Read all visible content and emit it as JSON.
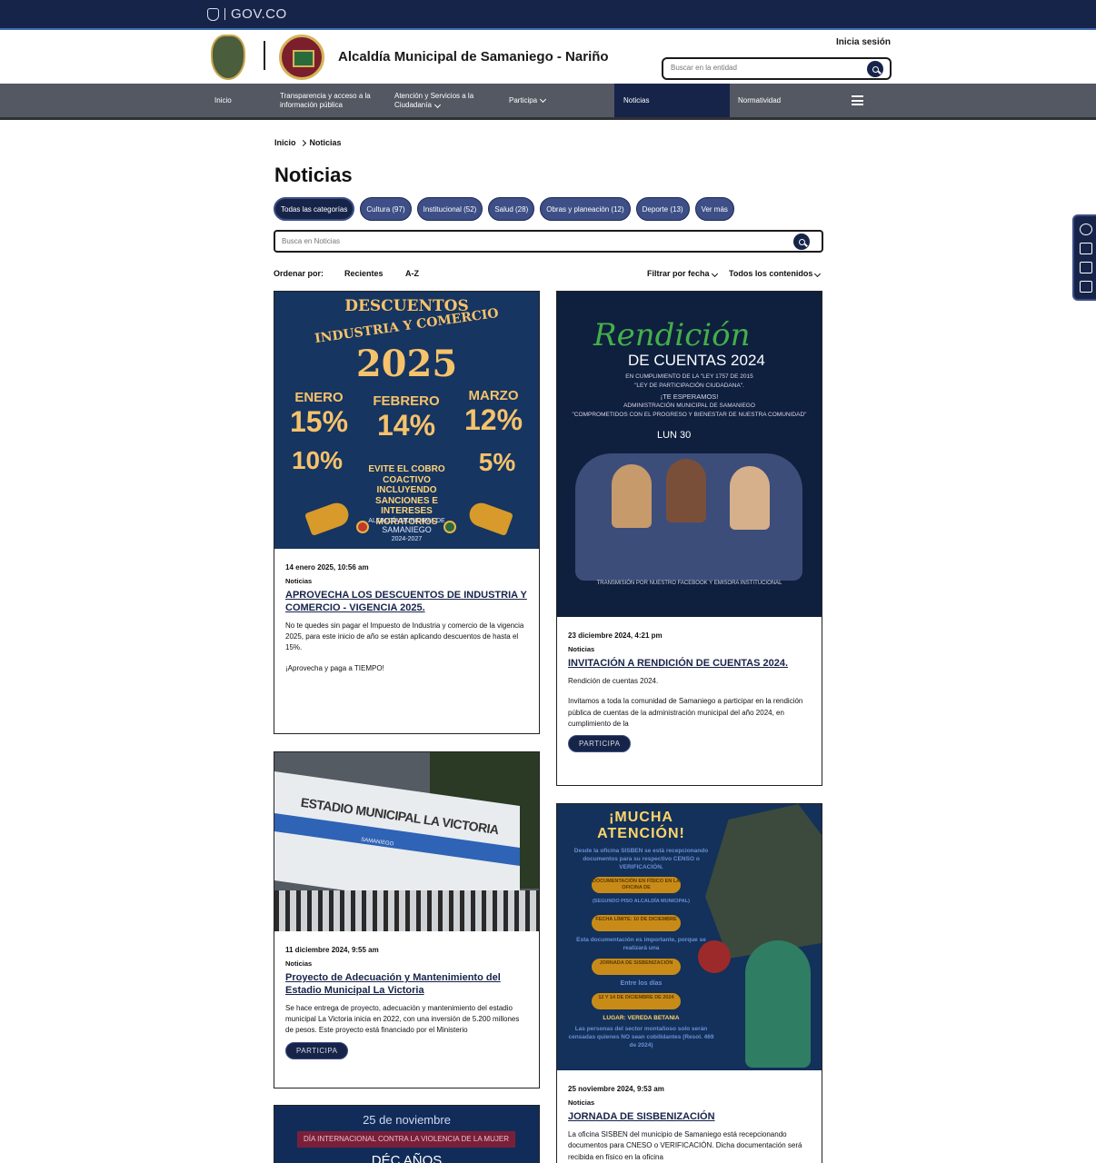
{
  "topbar": {
    "brand": "GOV.CO"
  },
  "header": {
    "site_title": "Alcaldía Municipal de Samaniego - Nariño",
    "login": "Inicia sesión",
    "search_placeholder": "Buscar en la entidad"
  },
  "nav": {
    "items": [
      {
        "label": "Inicio"
      },
      {
        "label": "Transparencia y acceso a la información pública"
      },
      {
        "label": "Atención y Servicios a la Ciudadanía"
      },
      {
        "label": "Participa"
      },
      {
        "label": "Noticias",
        "active": true
      },
      {
        "label": "Normatividad"
      }
    ],
    "menu_icon": "hamburger-icon"
  },
  "breadcrumb": {
    "home": "Inicio",
    "current": "Noticias"
  },
  "page_title": "Noticias",
  "categories": [
    {
      "label": "Todas las categorías",
      "active": true
    },
    {
      "label": "Cultura (97)"
    },
    {
      "label": "Institucional (52)"
    },
    {
      "label": "Salud (28)"
    },
    {
      "label": "Obras y planeación (12)"
    },
    {
      "label": "Deporte (13)"
    },
    {
      "label": "Ver más"
    }
  ],
  "news_search": {
    "placeholder": "Busca en Noticias"
  },
  "sort": {
    "label": "Ordenar por:",
    "options": [
      "Recientes",
      "A-Z"
    ],
    "filter_date": "Filtrar por fecha",
    "filter_content": "Todos los contenidos"
  },
  "cards": [
    {
      "date": "14 enero 2025, 10:56 am",
      "category": "Noticias",
      "title": "APROVECHA LOS DESCUENTOS DE INDUSTRIA Y COMERCIO - VIGENCIA 2025.",
      "excerpt": [
        "No te quedes sin pagar el Impuesto de Industria y comercio de la vigencia 2025, para este inicio de año se están aplicando descuentos de hasta el 15%.",
        "¡Aprovecha y paga a TIEMPO!"
      ],
      "image": {
        "l1": "DESCUENTOS",
        "l2": "INDUSTRIA Y COMERCIO",
        "year": "2025",
        "months": [
          {
            "m": "ENERO",
            "p": "15%"
          },
          {
            "m": "FEBRERO",
            "p": "14%"
          },
          {
            "m": "MARZO",
            "p": "12%"
          }
        ],
        "left_pct": "10%",
        "right_pct": "5%",
        "warn": "EVITE EL COBRO COACTIVO INCLUYENDO SANCIONES E INTERESES MORATORIOS",
        "footer1": "ALCALDÍA MUNICIPAL DE",
        "footer2": "SAMANIEGO",
        "footer3": "2024-2027"
      }
    },
    {
      "date": "23 diciembre 2024, 4:21 pm",
      "category": "Noticias",
      "title": "INVITACIÓN A RENDICIÓN DE CUENTAS 2024.",
      "excerpt": [
        "Rendición de cuentas 2024.",
        "Invitamos a toda la comunidad de Samaniego a participar en la rendición pública de cuentas de la administración municipal del año 2024, en cumplimiento de la"
      ],
      "button": "PARTICIPA",
      "image": {
        "script": "Rendición",
        "title": "DE CUENTAS 2024",
        "l1": "EN CUMPLIMIENTO DE LA \"LEY 1757 DE 2015",
        "l2": "\"LEY DE PARTICIPACIÓN CIUDADANA\".",
        "l3": "¡TE ESPERAMOS!",
        "l4": "ADMINISTRACIÓN MUNICIPAL DE SAMANIEGO",
        "l5": "\"COMPROMETIDOS CON EL PROGRESO Y BIENESTAR DE NUESTRA COMUNIDAD\"",
        "date": "LUN 30",
        "footer": "TRANSMISIÓN POR NUESTRO FACEBOOK Y EMISORA INSTITUCIONAL"
      }
    },
    {
      "date": "11 diciembre 2024, 9:55 am",
      "category": "Noticias",
      "title": "Proyecto de Adecuación y Mantenimiento del Estadio Municipal La Victoria",
      "excerpt": [
        "Se hace entrega de proyecto, adecuación y mantenimiento del estadio municipal La Victoria inicia en 2022, con una inversión de 5.200 millones de pesos. Este proyecto está financiado por el Ministerio"
      ],
      "button": "PARTICIPA",
      "image": {
        "sign": "ESTADIO MUNICIPAL LA VICTORIA",
        "sub": "SAMANIEGO"
      }
    },
    {
      "date": "25 noviembre 2024, 9:53 am",
      "category": "Noticias",
      "title": "JORNADA DE SISBENIZACIÓN",
      "excerpt": [
        "La oficina SISBEN del municipio de Samaniego está recepcionando documentos para CNESO o VERIFICACIÓN. Dicha documentación será recibida en físico en la oficina"
      ],
      "image": {
        "h1": "¡MUCHA",
        "h2": "ATENCIÓN!",
        "s1": "Desde la oficina SISBEN se está recepcionando documentos para su respectivo CENSO o VERIFICACIÓN.",
        "p1": "DOCUMENTACIÓN EN FÍSICO EN LA OFICINA DE",
        "p1b": "(SEGUNDO PISO ALCALDÍA MUNICIPAL)",
        "p2": "FECHA LÍMITE: 10 DE DICIEMBRE",
        "s2": "Esta documentación es importante, porque se realizará una",
        "p3": "JORNADA DE SISBENIZACIÓN",
        "s3": "Entre los días",
        "p4": "12 Y 14 DE DICIEMBRE DE 2024",
        "s4": "LUGAR: VEREDA BETANIA",
        "s5": "Las personas del sector montañoso solo serán censadas quienes NO sean cobilidantes (Resol. 469 de 2024)"
      }
    },
    {
      "image": {
        "l1": "25 de noviembre",
        "l2": "DÍA INTERNACIONAL CONTRA LA VIOLENCIA DE LA MUJER",
        "l3": "DÉC AÑOS"
      }
    }
  ]
}
